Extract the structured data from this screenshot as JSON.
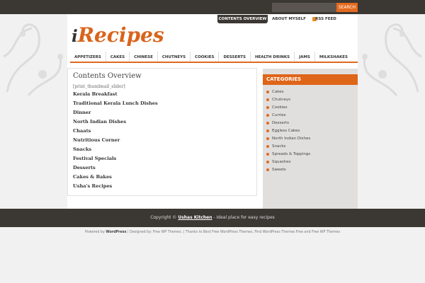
{
  "search": {
    "placeholder": "",
    "button_label": "SEARCH"
  },
  "top_nav": {
    "contents": "CONTENTS OVERVIEW",
    "about": "ABOUT MYSELF",
    "rss": "RSS FEED"
  },
  "logo": {
    "first": "i",
    "rest": "Recipes"
  },
  "menu": [
    "APPETIZERS",
    "CAKES",
    "CHINESE",
    "CHUTNEYS",
    "COOKIES",
    "DESSERTS",
    "HEALTH DRINKS",
    "JAMS",
    "MILKSHAKES"
  ],
  "main": {
    "title": "Contents Overview",
    "shortcode": "[print_thumbnail_slider]",
    "pages": [
      "Kerala Breakfast",
      "Traditional Kerala Lunch Dishes",
      "Dinner",
      "North Indian Dishes",
      "Chaats",
      "Nutritious Corner",
      "Snacks",
      "Festival Specials",
      "Desserts",
      "Cakes & Bakes",
      "Usha's Recipes"
    ]
  },
  "sidebar": {
    "title": "CATEGORIES",
    "categories": [
      "Cakes",
      "Chutneys",
      "Cookies",
      "Curries",
      "Desserts",
      "Eggless Cakes",
      "North Indian Dishes",
      "Snacks",
      "Spreads & Toppings",
      "Squashes",
      "Sweets"
    ]
  },
  "footer": {
    "copyright_prefix": "Copyright ©",
    "site_name": "Ushas Kitchen",
    "tagline": "- Ideal place for easy recipes"
  },
  "credits": {
    "powered_prefix": "Powered by",
    "wordpress": "WordPress",
    "rest": "| Designed by: Free WP Themes. | Thanks to Best Free WordPress Themes, Find WordPress Themes Free and Free WP Themes"
  },
  "colors": {
    "accent": "#df6519",
    "dark_bar": "#3b3733",
    "sidebar_bg": "#e1dfde"
  }
}
